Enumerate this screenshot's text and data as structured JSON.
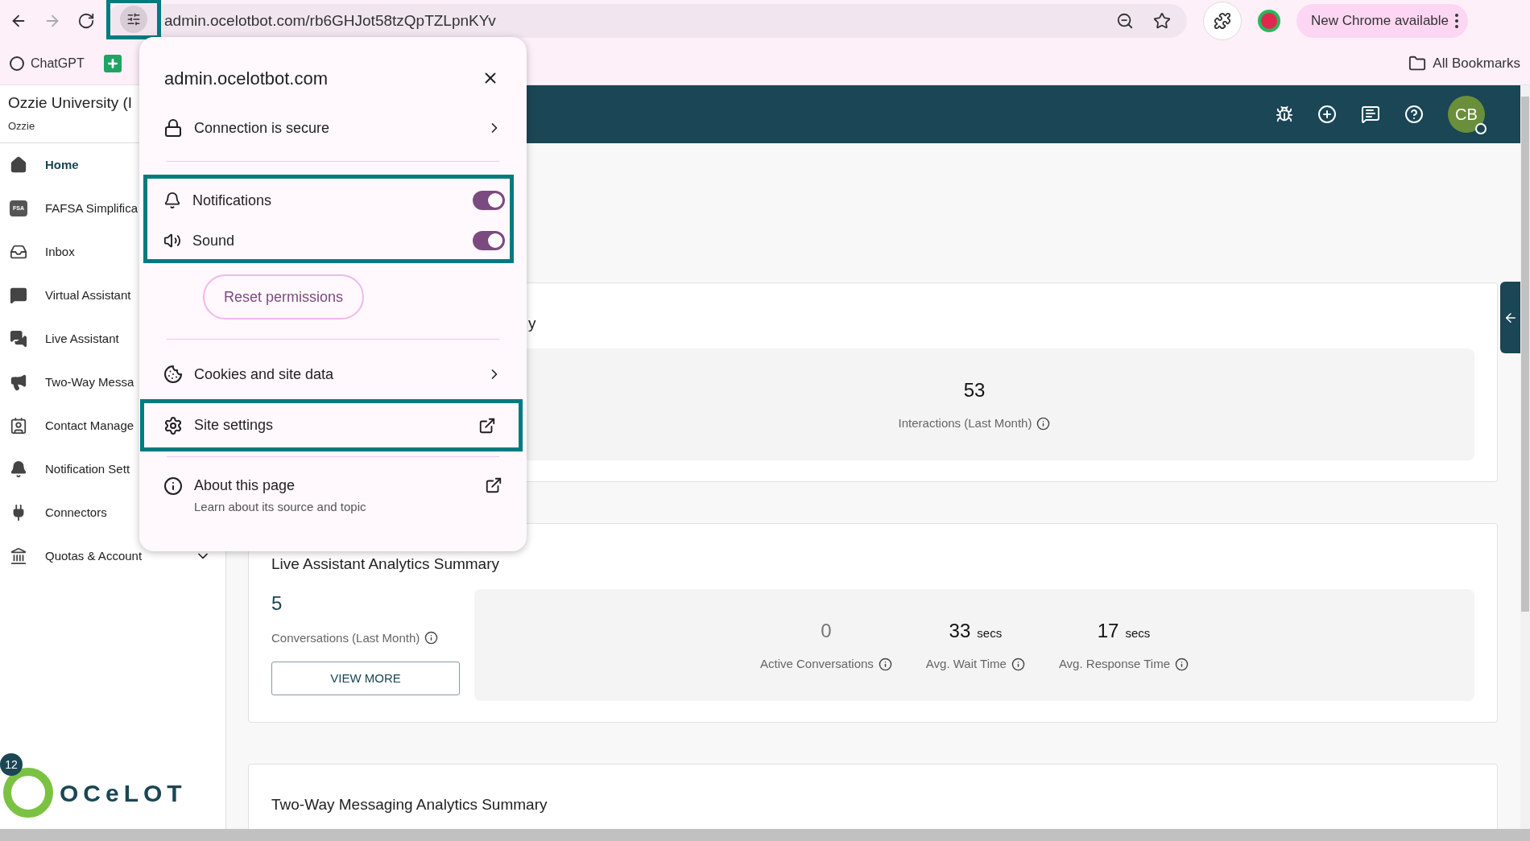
{
  "browser": {
    "address": "admin.ocelotbot.com/rb6GHJot58tzQpTZLpnKYv",
    "update_button": "New Chrome available",
    "bookmarks": [
      {
        "kind": "chatgpt",
        "label": "ChatGPT"
      },
      {
        "kind": "sheet"
      }
    ],
    "all_bookmarks": "All Bookmarks"
  },
  "site_info_popup": {
    "site": "admin.ocelotbot.com",
    "connection": "Connection is secure",
    "permissions": [
      {
        "kind": "bell",
        "label": "Notifications",
        "on": true
      },
      {
        "kind": "speaker",
        "label": "Sound",
        "on": true
      }
    ],
    "reset_button": "Reset permissions",
    "cookies": "Cookies and site data",
    "site_settings": "Site settings",
    "about": {
      "title": "About this page",
      "subtitle": "Learn about its source and topic"
    }
  },
  "sidebar": {
    "org": "Ozzie University (I",
    "org_sub": "Ozzie",
    "items": [
      {
        "kind": "home",
        "label": "Home",
        "selected": true,
        "submenu": false
      },
      {
        "kind": "fsa",
        "icon_text": "FSA",
        "label": "FAFSA Simplifica",
        "selected": false
      },
      {
        "kind": "inbox",
        "label": "Inbox",
        "selected": false
      },
      {
        "kind": "chat",
        "label": "Virtual Assistant",
        "selected": false
      },
      {
        "kind": "chats",
        "label": "Live Assistant",
        "selected": false
      },
      {
        "kind": "megaphone",
        "label": "Two-Way Messa",
        "selected": false
      },
      {
        "kind": "contact",
        "label": "Contact Manage",
        "selected": false
      },
      {
        "kind": "bell",
        "label": "Notification Sett",
        "selected": false
      },
      {
        "kind": "plug",
        "label": "Connectors",
        "selected": false
      },
      {
        "kind": "bank",
        "label": "Quotas & Account",
        "selected": false,
        "submenu": true
      }
    ],
    "badge": "12",
    "logo": "OCeLOT"
  },
  "header": {
    "avatar": "CB"
  },
  "cards": [
    {
      "title": "y",
      "stats": [
        {
          "value": "53",
          "label": "Interactions (Last Month)",
          "muted": false
        }
      ]
    },
    {
      "title": "Live Assistant Analytics Summary",
      "summary": {
        "value": "5",
        "label": "Conversations (Last Month)",
        "button": "VIEW MORE"
      },
      "stats": [
        {
          "value": "0",
          "label": "Active Conversations",
          "muted": true
        },
        {
          "value": "33",
          "unit": "secs",
          "label": "Avg. Wait Time",
          "muted": false
        },
        {
          "value": "17",
          "unit": "secs",
          "label": "Avg. Response Time",
          "muted": false
        }
      ]
    },
    {
      "title": "Two-Way Messaging Analytics Summary"
    }
  ]
}
